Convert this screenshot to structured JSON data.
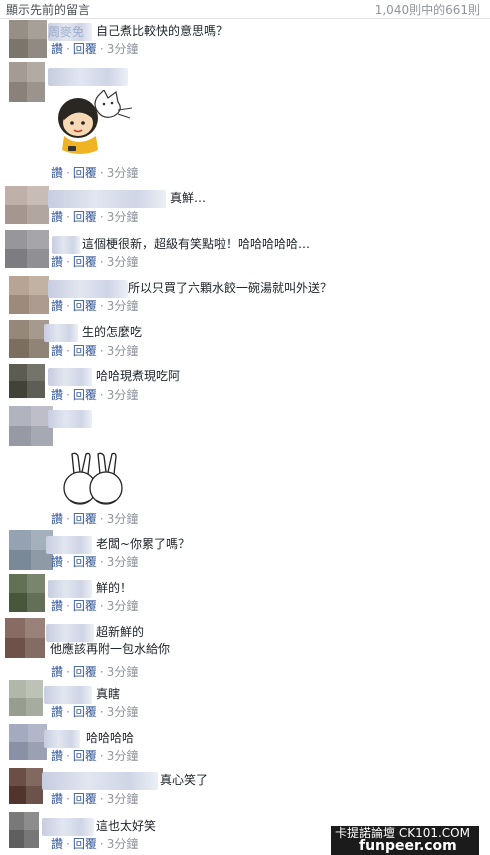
{
  "header": {
    "prev_comments_label": "顯示先前的留言",
    "count_label": "1,040則中的661則"
  },
  "actions": {
    "like": "讚",
    "reply": "回覆",
    "separator": "·",
    "time": "3分鐘"
  },
  "comments": [
    {
      "name": "周麥免",
      "text": "自己煮比較快的意思嗎？"
    },
    {
      "name": "",
      "text": "",
      "sticker": "girl-with-cat-sticker"
    },
    {
      "name": "",
      "text": "真鮮…"
    },
    {
      "name": "",
      "text": "這個梗很新，超級有笑點啦！哈哈哈哈哈…"
    },
    {
      "name": "",
      "text": "所以只買了六顆水餃一碗湯就叫外送？"
    },
    {
      "name": "",
      "text": "生的怎麼吃"
    },
    {
      "name": "",
      "text": "哈哈現煮現吃阿"
    },
    {
      "name": "",
      "text": "",
      "sticker": "two-rabbits-sticker"
    },
    {
      "name": "",
      "text": "老闆~你累了嗎？"
    },
    {
      "name": "",
      "text": "鮮的！"
    },
    {
      "name": "",
      "text_lines": [
        "超新鮮的",
        "他應該再附一包水給你"
      ]
    },
    {
      "name": "",
      "text": "真瞎"
    },
    {
      "name": "",
      "text": "哈哈哈哈"
    },
    {
      "name": "",
      "text": "真心笑了"
    },
    {
      "name": "",
      "text": "這也太好笑"
    }
  ],
  "colors": {
    "link": "#365899",
    "meta": "#90949c",
    "text": "#1d2129",
    "avatars": [
      "#8a8278",
      "#9a9088",
      "#b8a8a0",
      "#8a8a90",
      "#b09a88",
      "#8a7a6a",
      "#4a4a3e",
      "#a8aab8",
      "#8898a8",
      "#506040",
      "#7a5a50",
      "#a8b0a0",
      "#9aa0b8",
      "#5a3a30",
      "#6a6a6a"
    ]
  },
  "watermark": {
    "line1": "卡提諾論壇 CK101.COM",
    "line2": "funpeer.com"
  }
}
